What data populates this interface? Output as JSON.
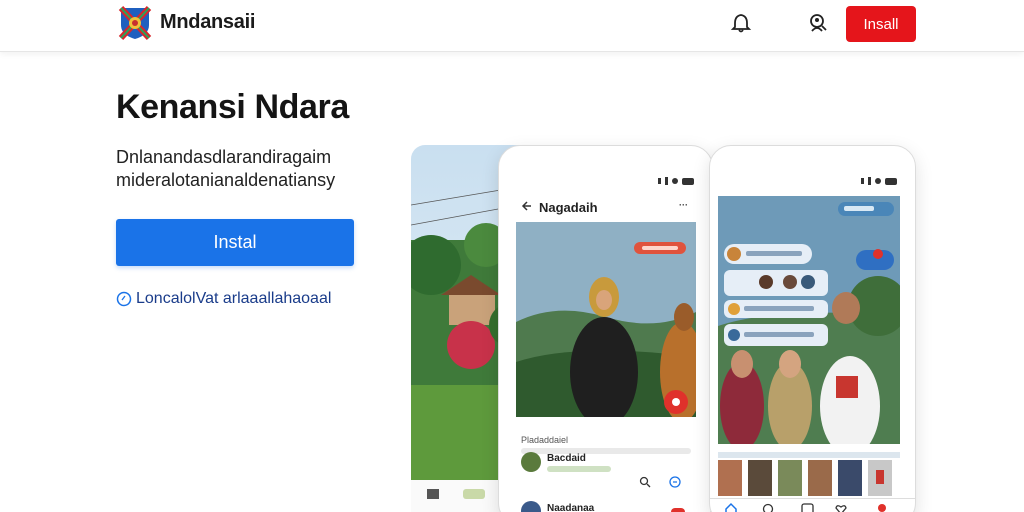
{
  "header": {
    "brand": "Mndansaii",
    "install_button": "Insall",
    "icons": [
      "bell-icon",
      "account-search-icon"
    ]
  },
  "hero": {
    "title": "Kenansi Ndara",
    "description_lines": [
      "Dnlanandasdlarandiragaim",
      "mideralotanianaldenatiansy"
    ],
    "install_button": "Instal",
    "link_text": "LoncalolVat arlaaallahaoaal"
  },
  "mockup": {
    "phone1": {
      "title": "Nagadaih",
      "post_caption": "Pladaddaiel",
      "post_name_1": "Bacdaid",
      "post_name_2": "Naadanaa"
    }
  },
  "colors": {
    "accent_blue": "#1a73e8",
    "brand_red": "#e5151b"
  }
}
